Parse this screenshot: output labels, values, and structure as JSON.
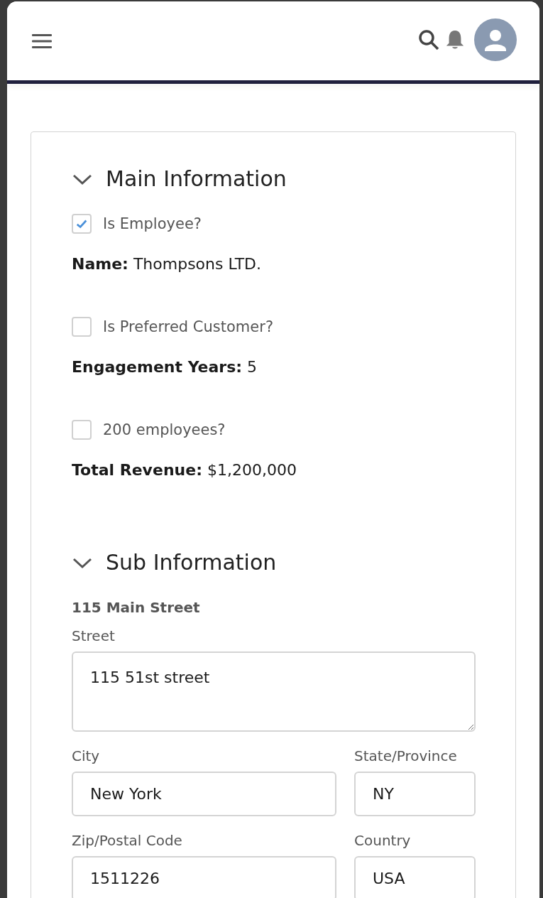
{
  "sections": [
    {
      "title": "Main Information",
      "expanded": true,
      "items": [
        {
          "kind": "checkbox",
          "label": "Is Employee?",
          "checked": true
        },
        {
          "kind": "field",
          "label": "Name:",
          "value": "Thompsons LTD."
        },
        {
          "kind": "checkbox",
          "label": "Is Preferred Customer?",
          "checked": false
        },
        {
          "kind": "field",
          "label": "Engagement Years:",
          "value": "5"
        },
        {
          "kind": "checkbox",
          "label": "200 employees?",
          "checked": false
        },
        {
          "kind": "field",
          "label": "Total Revenue:",
          "value": "$1,200,000"
        }
      ]
    },
    {
      "title": "Sub Information",
      "expanded": true,
      "address": {
        "title": "115 Main Street",
        "street": {
          "label": "Street",
          "value": "115 51st street"
        },
        "city": {
          "label": "City",
          "value": "New York"
        },
        "state": {
          "label": "State/Province",
          "value": "NY"
        },
        "zip": {
          "label": "Zip/Postal Code",
          "value": "1511226"
        },
        "country": {
          "label": "Country",
          "value": "USA"
        }
      }
    }
  ]
}
